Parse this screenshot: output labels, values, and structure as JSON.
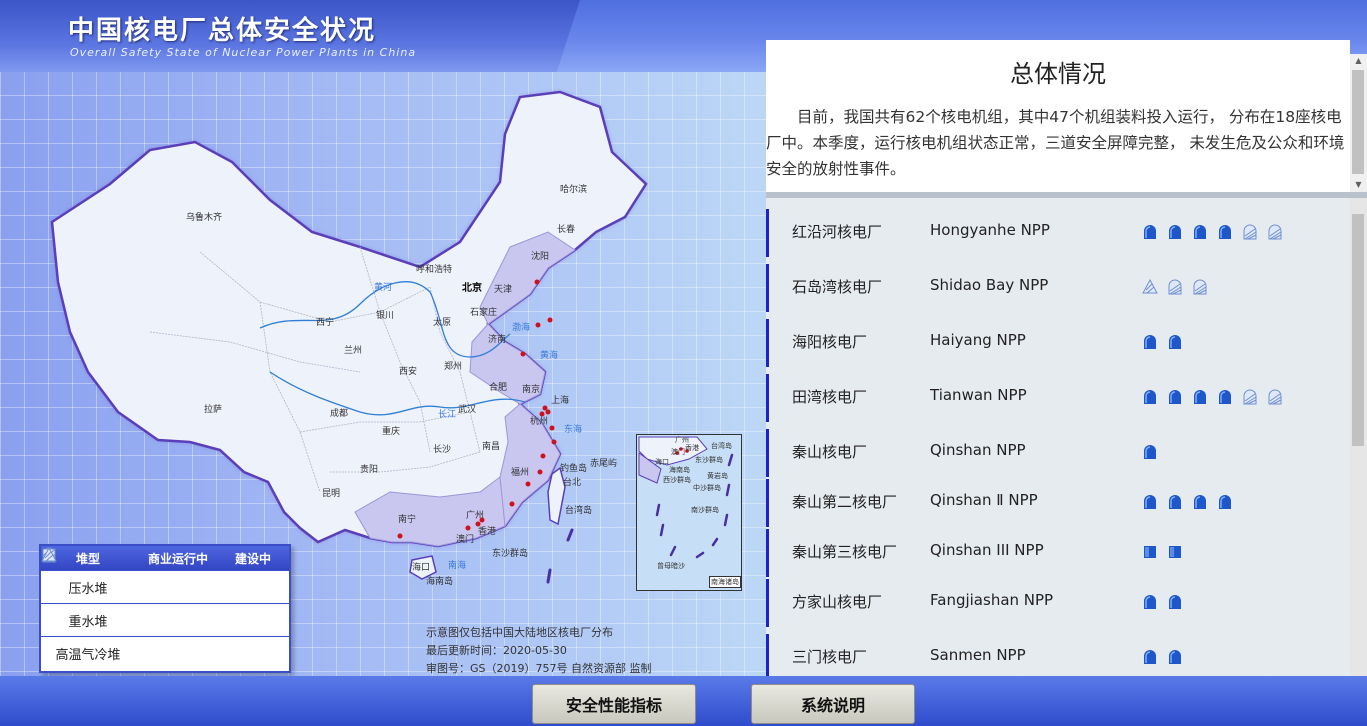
{
  "header": {
    "title": "中国核电厂总体安全状况",
    "subtitle": "Overall Safety State of Nuclear Power Plants in China"
  },
  "map": {
    "cities": [
      "哈尔滨",
      "长春",
      "乌鲁木齐",
      "沈阳",
      "呼和浩特",
      "北京",
      "天津",
      "石家庄",
      "银川",
      "太原",
      "西宁",
      "兰州",
      "济南",
      "郑州",
      "西安",
      "合肥",
      "南京",
      "上海",
      "武汉",
      "成都",
      "拉萨",
      "重庆",
      "杭州",
      "长沙",
      "南昌",
      "贵阳",
      "福州",
      "台北",
      "昆明",
      "南宁",
      "广州",
      "香港",
      "澳门",
      "海口"
    ],
    "features": [
      "渤海",
      "黄海",
      "东海",
      "钓鱼岛",
      "赤尾屿",
      "台湾岛",
      "南海",
      "东沙群岛",
      "海南岛",
      "黄河",
      "长江"
    ],
    "inset": {
      "places": [
        "广州",
        "香港",
        "澳门",
        "海口",
        "台湾岛",
        "东沙群岛",
        "海南岛",
        "西沙群岛",
        "中沙群岛",
        "南沙群岛",
        "黄岩岛",
        "曾母暗沙"
      ],
      "label": "南海诸岛"
    },
    "legend": {
      "headers": [
        "堆型",
        "商业运行中",
        "建设中"
      ],
      "rows": [
        {
          "type": "压水堆",
          "operating_icon": "pwr-dome-icon",
          "construction_icon": "pwr-dome-hatched-icon"
        },
        {
          "type": "重水堆",
          "operating_icon": "phwr-square-icon",
          "construction_icon": "phwr-square-hatched-icon"
        },
        {
          "type": "高温气冷堆",
          "operating_icon": "htgr-triangle-icon",
          "construction_icon": "htgr-triangle-hatched-icon"
        }
      ]
    },
    "notes": {
      "scope": "示意图仅包括中国大陆地区核电厂分布",
      "updated": "最后更新时间：2020-05-30",
      "approval": "审图号：GS（2019）757号 自然资源部 监制"
    }
  },
  "summary": {
    "title": "总体情况",
    "text": "目前，我国共有62个核电机组，其中47个机组装料投入运行， 分布在18座核电厂中。本季度，运行核电机组状态正常，三道安全屏障完整， 未发生危及公众和环境安全的放射性事件。"
  },
  "plants": [
    {
      "cn": "红沿河核电厂",
      "en": "Hongyanhe NPP",
      "units": [
        "pwr",
        "pwr",
        "pwr",
        "pwr",
        "pwr-c",
        "pwr-c"
      ]
    },
    {
      "cn": "石岛湾核电厂",
      "en": "Shidao Bay NPP",
      "units": [
        "htgr-c",
        "pwr-c",
        "pwr-c"
      ]
    },
    {
      "cn": "海阳核电厂",
      "en": "Haiyang NPP",
      "units": [
        "pwr",
        "pwr"
      ]
    },
    {
      "cn": "田湾核电厂",
      "en": "Tianwan NPP",
      "units": [
        "pwr",
        "pwr",
        "pwr",
        "pwr",
        "pwr-c",
        "pwr-c"
      ]
    },
    {
      "cn": "秦山核电厂",
      "en": "Qinshan NPP",
      "units": [
        "pwr"
      ]
    },
    {
      "cn": "秦山第二核电厂",
      "en": "Qinshan Ⅱ NPP",
      "units": [
        "pwr",
        "pwr",
        "pwr",
        "pwr"
      ]
    },
    {
      "cn": "秦山第三核电厂",
      "en": "Qinshan III NPP",
      "units": [
        "phwr",
        "phwr"
      ]
    },
    {
      "cn": "方家山核电厂",
      "en": "Fangjiashan NPP",
      "units": [
        "pwr",
        "pwr"
      ]
    },
    {
      "cn": "三门核电厂",
      "en": "Sanmen NPP",
      "units": [
        "pwr",
        "pwr"
      ]
    }
  ],
  "footer": {
    "buttons": [
      "安全性能指标",
      "系统说明"
    ]
  },
  "colors": {
    "header_blue": "#4f6fe0",
    "plant_dot": "#d0101a",
    "accent_bar": "#1b22c8",
    "icon_blue": "#1d57c9"
  }
}
